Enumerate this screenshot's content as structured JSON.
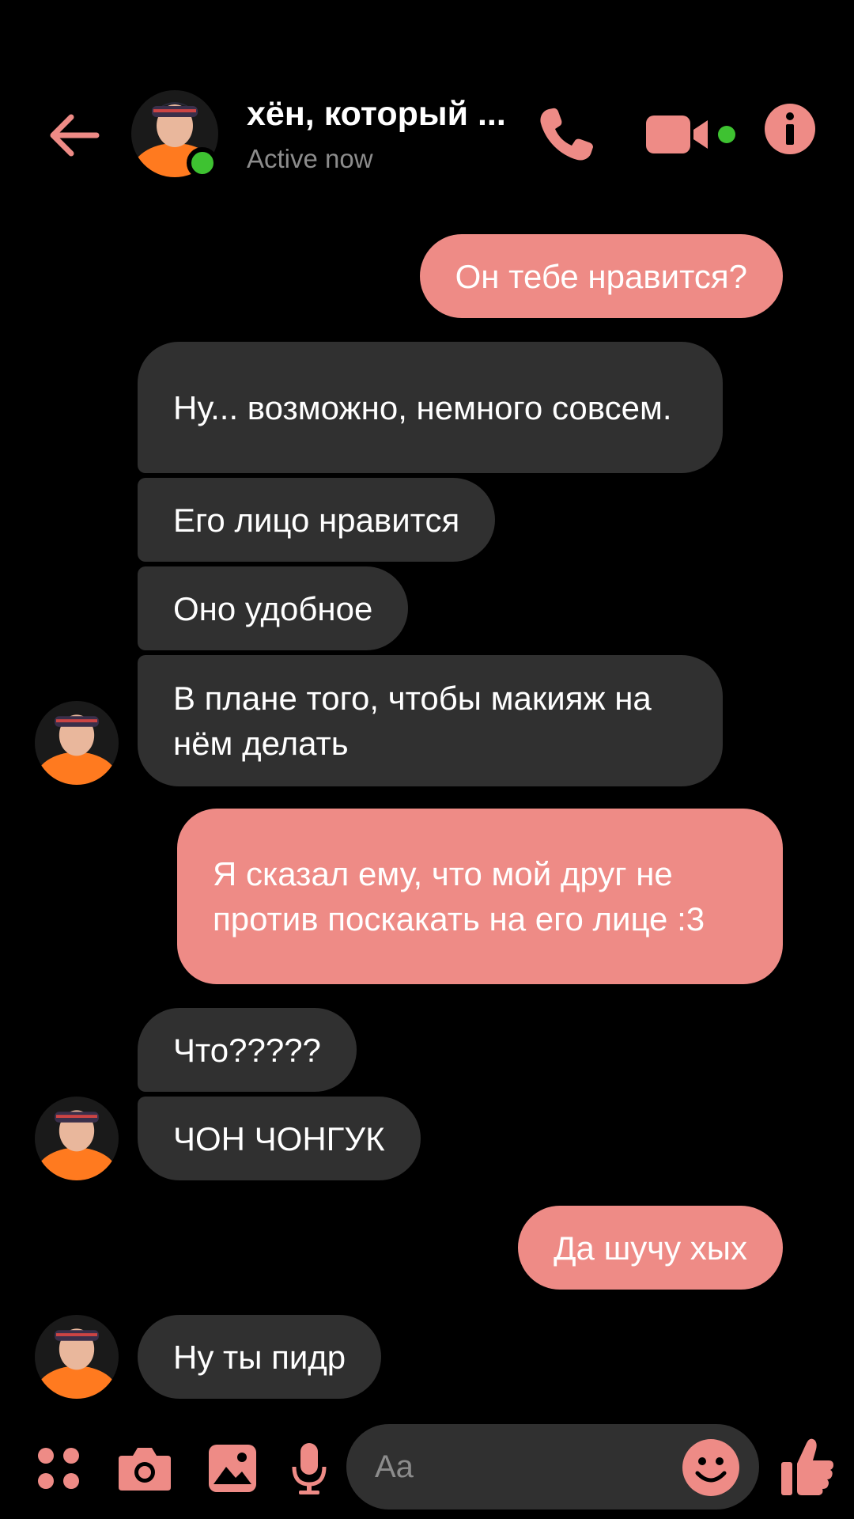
{
  "header": {
    "back_icon": "arrow-left-icon",
    "contact_name": "хён, который ...",
    "status": "Active now",
    "call_icon": "phone-icon",
    "video_icon": "video-camera-icon",
    "info_icon": "info-icon"
  },
  "messages": [
    {
      "direction": "outgoing",
      "text": "Он тебе нравится?"
    },
    {
      "direction": "incoming",
      "text": "Ну... возможно, немного совсем."
    },
    {
      "direction": "incoming",
      "text": "Его лицо нравится"
    },
    {
      "direction": "incoming",
      "text": "Оно удобное"
    },
    {
      "direction": "incoming",
      "text": "В плане того, чтобы макияж на нём делать"
    },
    {
      "direction": "outgoing",
      "text": "Я сказал ему, что мой друг не против поскакать на его лице :3"
    },
    {
      "direction": "incoming",
      "text": "Что?????"
    },
    {
      "direction": "incoming",
      "text": "ЧОН ЧОНГУК"
    },
    {
      "direction": "outgoing",
      "text": "Да шучу хых"
    },
    {
      "direction": "incoming",
      "text": "Ну ты пидр"
    }
  ],
  "composer": {
    "placeholder": "Aa",
    "icons": [
      "apps-icon",
      "camera-icon",
      "image-icon",
      "microphone-icon",
      "emoji-icon",
      "thumbs-up-icon"
    ]
  },
  "colors": {
    "accent": "#ee8b86",
    "incoming_bubble": "#303030",
    "online": "#3ec231",
    "background": "#000000"
  }
}
